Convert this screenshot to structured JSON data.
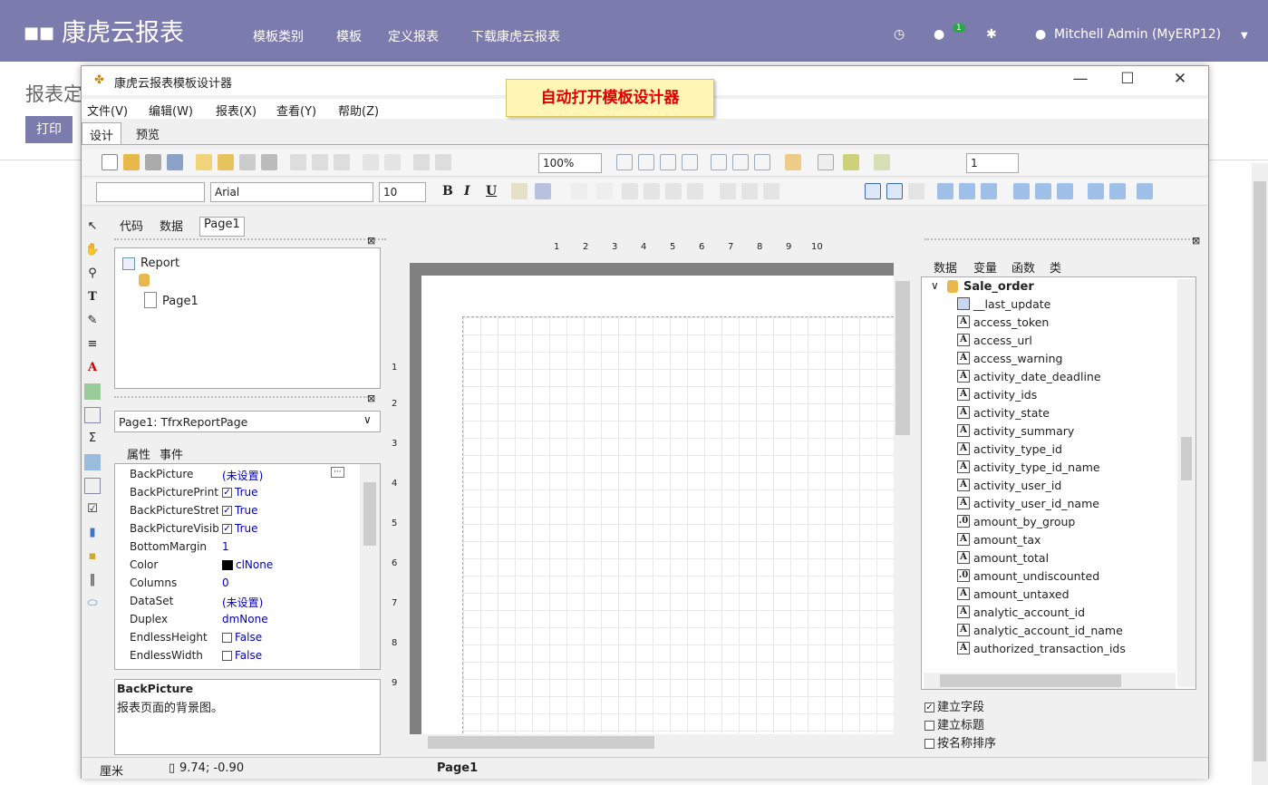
{
  "topbar": {
    "apps_icon": "apps-grid-icon",
    "brand": "康虎云报表",
    "nav": [
      "模板类别",
      "模板",
      "定义报表",
      "下载康虎云报表"
    ],
    "chat_count": "1",
    "user": "Mitchell Admin (MyERP12)"
  },
  "page": {
    "title": "报表定",
    "print_button": "打印"
  },
  "window": {
    "title": "康虎云报表模板设计器",
    "minimize": "—",
    "maximize": "☐",
    "close": "✕",
    "callout": "自动打开模板设计器",
    "menu": [
      "文件(V)",
      "编辑(W)",
      "报表(X)",
      "查看(Y)",
      "帮助(Z)"
    ],
    "design_tabs": [
      "设计",
      "预览"
    ]
  },
  "toolbar": {
    "zoom": "100%",
    "font_name": "Arial",
    "font_size": "10",
    "line_width": "1",
    "bold": "B",
    "italic": "I",
    "underline": "U"
  },
  "page_tabs": [
    "代码",
    "数据",
    "Page1"
  ],
  "tree": {
    "root": "Report",
    "page": "Page1"
  },
  "object_selector": "Page1: TfrxReportPage",
  "inspector_tabs": [
    "属性",
    "事件"
  ],
  "properties": [
    {
      "name": "BackPicture",
      "value": "(未设置)"
    },
    {
      "name": "BackPicturePrint",
      "value": "True"
    },
    {
      "name": "BackPictureStret",
      "value": "True"
    },
    {
      "name": "BackPictureVisibl",
      "value": "True"
    },
    {
      "name": "BottomMargin",
      "value": "1"
    },
    {
      "name": "Color",
      "value": "clNone"
    },
    {
      "name": "Columns",
      "value": "0"
    },
    {
      "name": "DataSet",
      "value": "(未设置)"
    },
    {
      "name": "Duplex",
      "value": "dmNone"
    },
    {
      "name": "EndlessHeight",
      "value": "False"
    },
    {
      "name": "EndlessWidth",
      "value": "False"
    }
  ],
  "prop_help": {
    "name": "BackPicture",
    "desc": "报表页面的背景图。"
  },
  "ruler": {
    "h": [
      "1",
      "2",
      "3",
      "4",
      "5",
      "6",
      "7",
      "8",
      "9",
      "10"
    ],
    "v": [
      "1",
      "2",
      "3",
      "4",
      "5",
      "6",
      "7",
      "8",
      "9"
    ]
  },
  "data_tabs": [
    "数据",
    "变量",
    "函数",
    "类"
  ],
  "dataset": "Sale_order",
  "fields": [
    {
      "type": "grid",
      "name": "__last_update"
    },
    {
      "type": "A",
      "name": "access_token"
    },
    {
      "type": "A",
      "name": "access_url"
    },
    {
      "type": "A",
      "name": "access_warning"
    },
    {
      "type": "A",
      "name": "activity_date_deadline"
    },
    {
      "type": "A",
      "name": "activity_ids"
    },
    {
      "type": "A",
      "name": "activity_state"
    },
    {
      "type": "A",
      "name": "activity_summary"
    },
    {
      "type": "A",
      "name": "activity_type_id"
    },
    {
      "type": "A",
      "name": "activity_type_id_name"
    },
    {
      "type": "A",
      "name": "activity_user_id"
    },
    {
      "type": "A",
      "name": "activity_user_id_name"
    },
    {
      "type": ".0",
      "name": "amount_by_group"
    },
    {
      "type": "A",
      "name": "amount_tax"
    },
    {
      "type": "A",
      "name": "amount_total"
    },
    {
      "type": ".0",
      "name": "amount_undiscounted"
    },
    {
      "type": "A",
      "name": "amount_untaxed"
    },
    {
      "type": "A",
      "name": "analytic_account_id"
    },
    {
      "type": "A",
      "name": "analytic_account_id_name"
    },
    {
      "type": "A",
      "name": "authorized_transaction_ids"
    }
  ],
  "checkboxes": [
    {
      "label": "建立字段",
      "checked": true
    },
    {
      "label": "建立标题",
      "checked": false
    },
    {
      "label": "按名称排序",
      "checked": false
    }
  ],
  "status": {
    "unit": "厘米",
    "coords": "9.74; -0.90",
    "page": "Page1"
  }
}
